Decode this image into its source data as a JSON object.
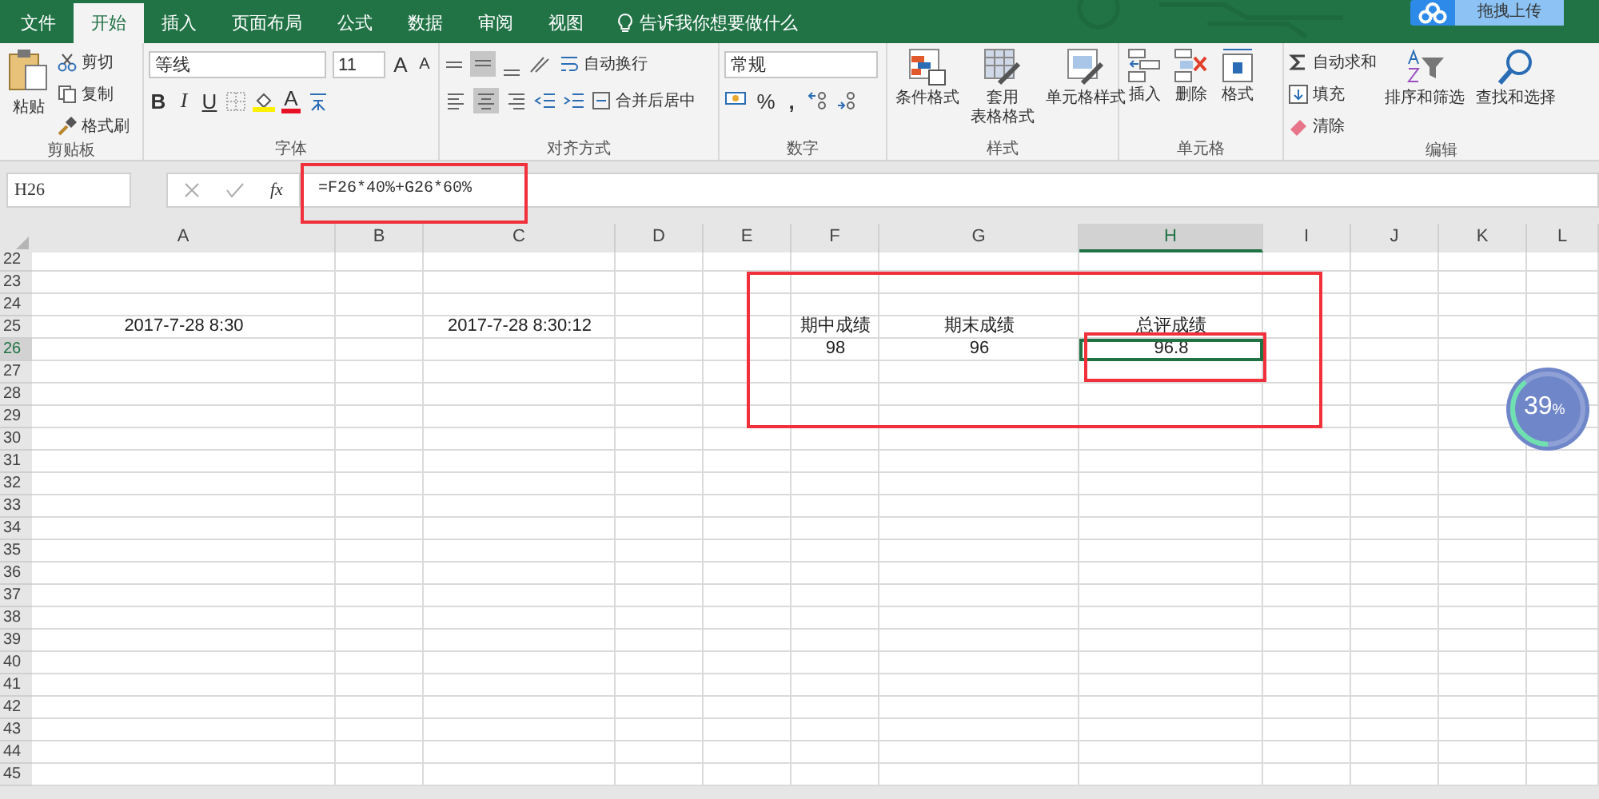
{
  "menu_tabs": [
    {
      "label": "文件",
      "selected": false
    },
    {
      "label": "开始",
      "selected": true
    },
    {
      "label": "插入",
      "selected": false
    },
    {
      "label": "页面布局",
      "selected": false
    },
    {
      "label": "公式",
      "selected": false
    },
    {
      "label": "数据",
      "selected": false
    },
    {
      "label": "审阅",
      "selected": false
    },
    {
      "label": "视图",
      "selected": false
    }
  ],
  "tell_me": "告诉我你想要做什么",
  "upload_button": "拖拽上传",
  "ribbon": {
    "clipboard": {
      "title": "剪贴板",
      "paste": "粘贴",
      "cut": "剪切",
      "copy": "复制",
      "format_painter": "格式刷"
    },
    "font": {
      "title": "字体",
      "font_name": "等线",
      "font_size": "11",
      "grow": "A",
      "shrink": "A",
      "bold": "B",
      "italic": "I",
      "underline": "U",
      "font_color": "A"
    },
    "alignment": {
      "title": "对齐方式",
      "wrap_text": "自动换行",
      "merge_center": "合并后居中"
    },
    "number": {
      "title": "数字",
      "format": "常规",
      "percent": "%",
      "comma": ","
    },
    "styles": {
      "title": "样式",
      "items": [
        {
          "kind": "conditional",
          "label": "条件格式"
        },
        {
          "kind": "table",
          "label": [
            "套用",
            "表格格式"
          ]
        },
        {
          "kind": "cell",
          "label": "单元格样式"
        }
      ]
    },
    "cells": {
      "title": "单元格",
      "items": [
        {
          "kind": "insert",
          "label": "插入"
        },
        {
          "kind": "delete",
          "label": "删除"
        },
        {
          "kind": "format",
          "label": "格式"
        }
      ]
    },
    "editing": {
      "title": "编辑",
      "autosum": "自动求和",
      "fill": "填充",
      "clear": "清除",
      "sort_filter": "排序和筛选",
      "find_select": "查找和选择"
    }
  },
  "formula_bar": {
    "name_box": "H26",
    "fx": "fx",
    "formula": "=F26*40%+G26*60%"
  },
  "sheet": {
    "columns": [
      {
        "label": "A",
        "selected": false
      },
      {
        "label": "B",
        "selected": false
      },
      {
        "label": "C",
        "selected": false
      },
      {
        "label": "D",
        "selected": false
      },
      {
        "label": "E",
        "selected": false
      },
      {
        "label": "F",
        "selected": false
      },
      {
        "label": "G",
        "selected": false
      },
      {
        "label": "H",
        "selected": true
      },
      {
        "label": "I",
        "selected": false
      },
      {
        "label": "J",
        "selected": false
      },
      {
        "label": "K",
        "selected": false
      },
      {
        "label": "L",
        "selected": false
      }
    ],
    "rows": [
      {
        "header": "22",
        "selected": false,
        "cells": []
      },
      {
        "header": "23",
        "selected": false,
        "cells": []
      },
      {
        "header": "24",
        "selected": false,
        "cells": []
      },
      {
        "header": "25",
        "selected": false,
        "cells": [
          {
            "text": "2017-7-28 8:30",
            "selected": false
          },
          {
            "text": "",
            "selected": false
          },
          {
            "text": "2017-7-28 8:30:12",
            "selected": false
          },
          {
            "text": "",
            "selected": false
          },
          {
            "text": "",
            "selected": false
          },
          {
            "text": "期中成绩",
            "selected": false
          },
          {
            "text": "期末成绩",
            "selected": false
          },
          {
            "text": "总评成绩",
            "selected": false
          }
        ]
      },
      {
        "header": "26",
        "selected": true,
        "cells": [
          {
            "text": "",
            "selected": false
          },
          {
            "text": "",
            "selected": false
          },
          {
            "text": "",
            "selected": false
          },
          {
            "text": "",
            "selected": false
          },
          {
            "text": "",
            "selected": false
          },
          {
            "text": "98",
            "selected": false
          },
          {
            "text": "96",
            "selected": false
          },
          {
            "text": "96.8",
            "selected": true
          }
        ]
      },
      {
        "header": "27",
        "selected": false,
        "cells": []
      },
      {
        "header": "28",
        "selected": false,
        "cells": []
      },
      {
        "header": "29",
        "selected": false,
        "cells": []
      },
      {
        "header": "30",
        "selected": false,
        "cells": []
      },
      {
        "header": "31",
        "selected": false,
        "cells": []
      },
      {
        "header": "32",
        "selected": false,
        "cells": []
      },
      {
        "header": "33",
        "selected": false,
        "cells": []
      },
      {
        "header": "34",
        "selected": false,
        "cells": []
      },
      {
        "header": "35",
        "selected": false,
        "cells": []
      },
      {
        "header": "36",
        "selected": false,
        "cells": []
      },
      {
        "header": "37",
        "selected": false,
        "cells": []
      },
      {
        "header": "38",
        "selected": false,
        "cells": []
      },
      {
        "header": "39",
        "selected": false,
        "cells": []
      },
      {
        "header": "40",
        "selected": false,
        "cells": []
      },
      {
        "header": "41",
        "selected": false,
        "cells": []
      },
      {
        "header": "42",
        "selected": false,
        "cells": []
      },
      {
        "header": "43",
        "selected": false,
        "cells": []
      },
      {
        "header": "44",
        "selected": false,
        "cells": []
      },
      {
        "header": "45",
        "selected": false,
        "cells": []
      }
    ]
  },
  "progress_widget": {
    "value": "39",
    "unit": "%",
    "level": 0.39
  }
}
